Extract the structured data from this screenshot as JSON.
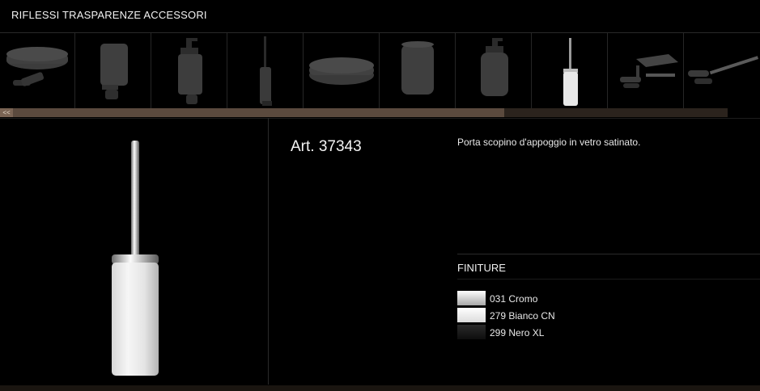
{
  "header": {
    "title": "RIFLESSI TRASPARENZE ACCESSORI"
  },
  "scroller": {
    "left_label": "<<"
  },
  "thumbnails": [
    {
      "name": "thumb-soap-dish"
    },
    {
      "name": "thumb-tumbler"
    },
    {
      "name": "thumb-soap-dispenser"
    },
    {
      "name": "thumb-brush-holder-wall"
    },
    {
      "name": "thumb-soap-dish-freestanding"
    },
    {
      "name": "thumb-tumbler-freestanding"
    },
    {
      "name": "thumb-soap-dispenser-freestanding"
    },
    {
      "name": "thumb-brush-holder-freestanding"
    },
    {
      "name": "thumb-shelf"
    },
    {
      "name": "thumb-towel-bar"
    }
  ],
  "product": {
    "article": "Art. 37343",
    "description": "Porta scopino d'appoggio in vetro satinato."
  },
  "finishes": {
    "title": "FINITURE",
    "items": [
      {
        "code_label": "031 Cromo",
        "color": "#d9d9d9"
      },
      {
        "code_label": "279 Bianco CN",
        "color": "#f7f7f7"
      },
      {
        "code_label": "299 Nero XL",
        "color": "#151515"
      }
    ]
  }
}
